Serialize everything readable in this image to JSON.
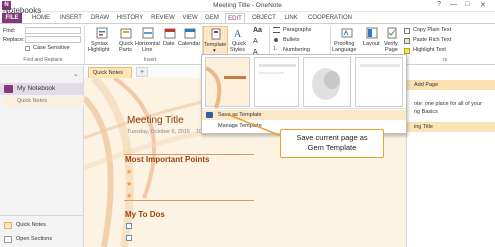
{
  "window": {
    "title": "Meeting Title - OneNote",
    "controls": [
      "?",
      "—",
      "□",
      "✕"
    ]
  },
  "tabs": [
    "FILE",
    "HOME",
    "INSERT",
    "DRAW",
    "HISTORY",
    "REVIEW",
    "VIEW",
    "GEM",
    "EDIT",
    "OBJECT",
    "LINK",
    "COOPERATION"
  ],
  "ribbon": {
    "find_label": "Find:",
    "replace_label": "Replace:",
    "case_sensitive": "Case Sensitive",
    "group_find": "Find and Replace",
    "group_insert": "Insert",
    "syntax_highlight": [
      "Syntax",
      "Highlight"
    ],
    "quick_parts": [
      "Quick",
      "Parts"
    ],
    "horizontal_line": [
      "Horizontal",
      "Line"
    ],
    "date": [
      "Date"
    ],
    "calendar": [
      "Calendar"
    ],
    "template": "Template",
    "quick_styles": [
      "Quick",
      "Styles"
    ],
    "paragraphs": "Paragraphs",
    "bullets": "Bullets",
    "numbering": "Numbering",
    "proofing_language": [
      "Proofing",
      "Language"
    ],
    "layout": "Layout",
    "verify_page": [
      "Verify",
      "Page"
    ],
    "copy_plain_text": "Copy Plain Text",
    "paste_rich_text": "Paste Rich Text",
    "highlight_text": "Highlight Text",
    "right_group_suffix": "rs",
    "dropdown_arrow": "▾"
  },
  "nav": {
    "notebooks_title": "Notebooks",
    "pin": "⫠",
    "notebook": "My Notebook",
    "section": "Quick Notes",
    "bottom_quick_notes": "Quick Notes",
    "open_sections": "Open Sections"
  },
  "section_tab": {
    "label": "Quick Notes",
    "add": "+"
  },
  "page": {
    "title": "Meeting Title",
    "date": "Tuesday, October 6, 2015",
    "time": "10:03 AM",
    "heading1": "Most Important Points",
    "heading2": "My To Dos"
  },
  "dropdown": {
    "save_as_template": "Save as Template",
    "manage_template": "Manage Template"
  },
  "callout": {
    "line1": "Save current page as",
    "line2": "Gem Template"
  },
  "right_pane": {
    "add_page": "Add Page",
    "line1": "ote: one place for all of your",
    "line2": "ng Basics",
    "selected_page": "ing Title"
  },
  "colors": {
    "accent": "#80397b",
    "orange": "#f0a02c",
    "heading": "#a0410e"
  }
}
